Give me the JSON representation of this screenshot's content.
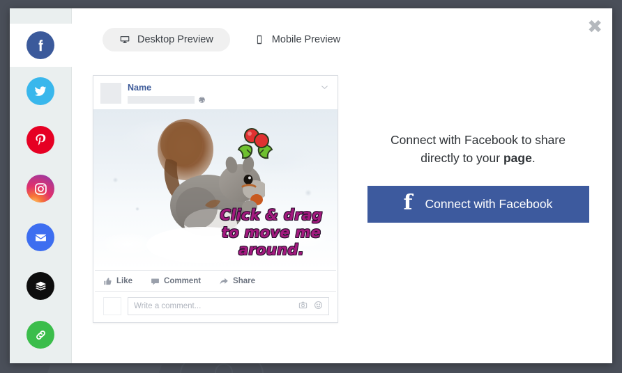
{
  "window": {
    "close_label": "✖"
  },
  "sidebar": {
    "items": [
      {
        "name": "facebook",
        "icon": "facebook-icon",
        "active": true
      },
      {
        "name": "twitter",
        "icon": "twitter-icon",
        "active": false
      },
      {
        "name": "pinterest",
        "icon": "pinterest-icon",
        "active": false
      },
      {
        "name": "instagram",
        "icon": "instagram-icon",
        "active": false
      },
      {
        "name": "email",
        "icon": "envelope-icon",
        "active": false
      },
      {
        "name": "buffer",
        "icon": "buffer-layers-icon",
        "active": false
      },
      {
        "name": "link",
        "icon": "chain-link-icon",
        "active": false
      }
    ]
  },
  "tabs": [
    {
      "label": "Desktop Preview",
      "icon": "desktop-monitor-icon",
      "active": true
    },
    {
      "label": "Mobile Preview",
      "icon": "mobile-phone-icon",
      "active": false
    }
  ],
  "post_preview": {
    "author_name": "Name",
    "privacy_icon": "globe-icon",
    "more_icon": "chevron-down-icon",
    "image": {
      "alt": "squirrel-in-snow-photo",
      "sticker": "holly-berries-sticker",
      "overlay_text": "Click & drag\nto move me\naround.",
      "overlay_text_lines": [
        "Click & drag",
        "to move me",
        "around."
      ],
      "overlay_text_color": "#a3197f"
    },
    "actions": [
      {
        "label": "Like",
        "icon": "thumbs-up-icon"
      },
      {
        "label": "Comment",
        "icon": "speech-bubble-icon"
      },
      {
        "label": "Share",
        "icon": "share-arrow-icon"
      }
    ],
    "comment_box": {
      "placeholder": "Write a comment...",
      "camera_icon": "camera-icon",
      "emoji_icon": "emoji-smiley-icon"
    }
  },
  "connect_panel": {
    "message_part1": "Connect with Facebook to share directly to your ",
    "message_bold": "page",
    "message_part3": ".",
    "button_label": "Connect with Facebook",
    "button_icon": "facebook-f-icon",
    "button_color": "#3d5a9e"
  }
}
